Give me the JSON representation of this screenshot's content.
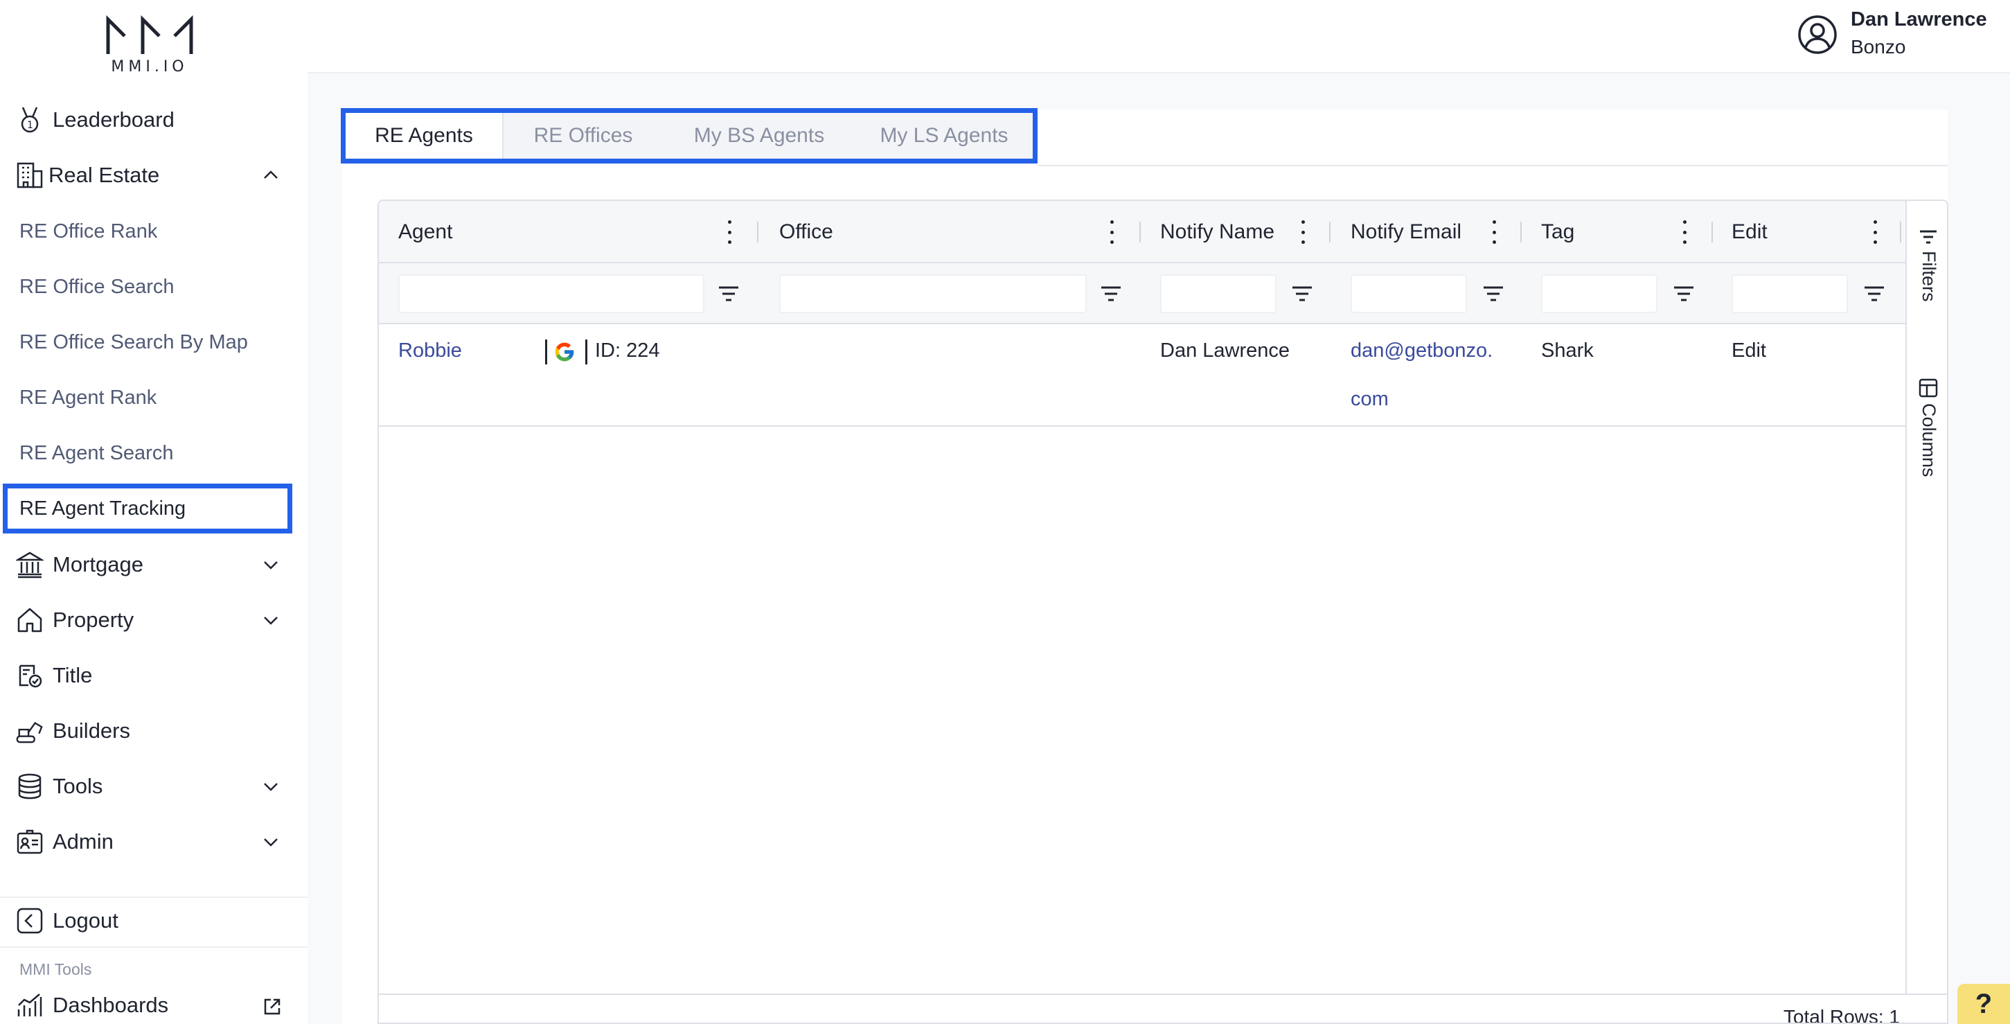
{
  "brand": {
    "logo_text": "MMI.IO"
  },
  "user": {
    "name": "Dan Lawrence",
    "org": "Bonzo"
  },
  "sidebar": {
    "items": [
      {
        "label": "Leaderboard"
      },
      {
        "label": "Real Estate",
        "expanded": true
      },
      {
        "label": "Mortgage"
      },
      {
        "label": "Property"
      },
      {
        "label": "Title"
      },
      {
        "label": "Builders"
      },
      {
        "label": "Tools"
      },
      {
        "label": "Admin"
      }
    ],
    "real_estate_sub": [
      {
        "label": "RE Office Rank"
      },
      {
        "label": "RE Office Search"
      },
      {
        "label": "RE Office Search By Map"
      },
      {
        "label": "RE Agent Rank"
      },
      {
        "label": "RE Agent Search"
      },
      {
        "label": "RE Agent Tracking",
        "active": true
      }
    ],
    "logout_label": "Logout",
    "tools_section_label": "MMI Tools",
    "dashboards_label": "Dashboards"
  },
  "tabs": [
    {
      "label": "RE Agents",
      "active": true
    },
    {
      "label": "RE Offices"
    },
    {
      "label": "My BS Agents"
    },
    {
      "label": "My LS Agents"
    }
  ],
  "grid": {
    "columns": [
      "Agent",
      "Office",
      "Notify Name",
      "Notify Email",
      "Tag",
      "Edit"
    ],
    "rows": [
      {
        "agent": "Robbie",
        "agent_id": "ID: 224",
        "office": "",
        "notify_name": "Dan Lawrence",
        "notify_email_line1": "dan@getbonzo.",
        "notify_email_line2": "com",
        "tag": "Shark",
        "edit": "Edit"
      }
    ],
    "side_panel": {
      "filters_label": "Filters",
      "columns_label": "Columns"
    },
    "footer": {
      "total_rows": "Total Rows: 1"
    }
  },
  "help": {
    "label": "?"
  },
  "colors": {
    "accent": "#2461e8",
    "link": "#3a4a9a",
    "help_bg": "#f7e07a"
  }
}
